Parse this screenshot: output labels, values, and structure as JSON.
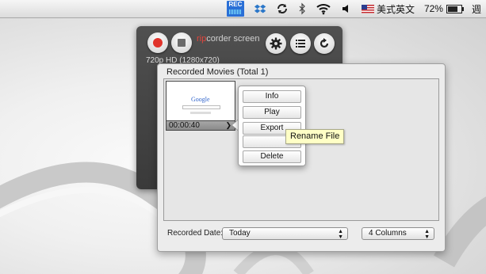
{
  "menubar": {
    "rec_badge": "REC",
    "input_method": "美式英文",
    "battery_percent": "72%",
    "battery_level": 0.72,
    "clock": "週"
  },
  "hud": {
    "logo_rip": "rip",
    "logo_rest": "corder screen",
    "resolution": "720p HD (1280x720)"
  },
  "panel": {
    "title": "Recorded Movies (Total 1)",
    "thumbnail": {
      "logo": "Google",
      "duration": "00:00:40",
      "arrow": "❯"
    },
    "recorded_date_label": "Recorded Date:",
    "date_select": "Today",
    "columns_select": "4 Columns"
  },
  "context_menu": {
    "items": [
      "Info",
      "Play",
      "Export",
      "",
      "Delete"
    ]
  },
  "tooltip": "Rename File"
}
